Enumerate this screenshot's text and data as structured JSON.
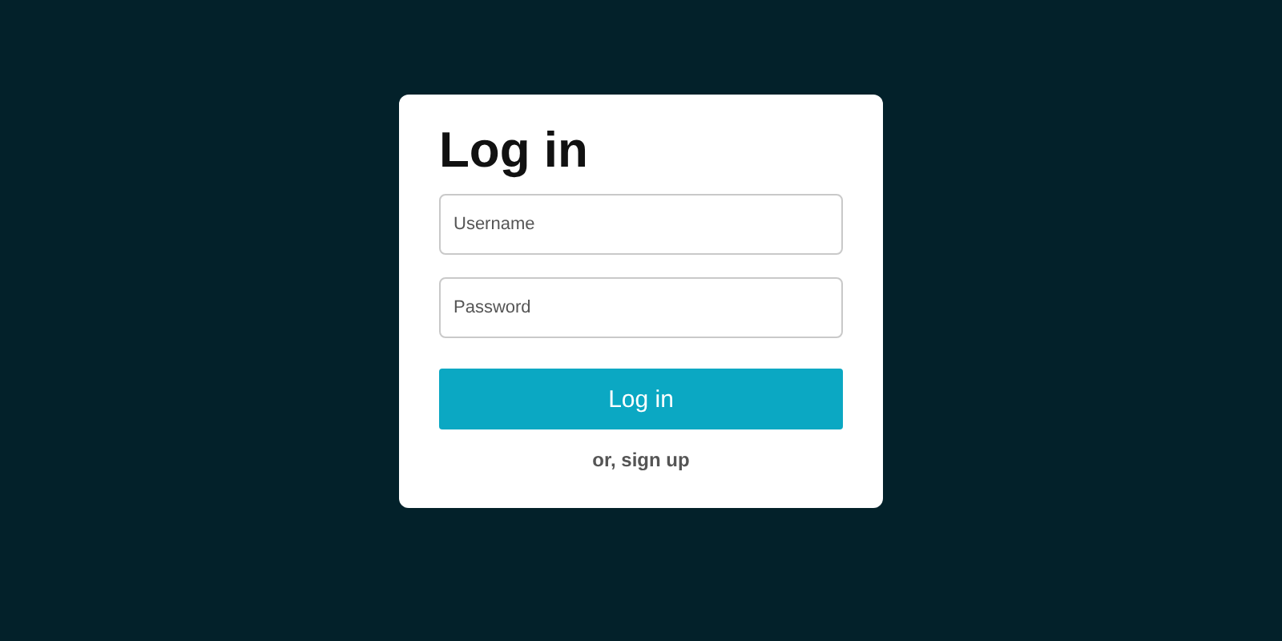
{
  "login_card": {
    "title": "Log in",
    "username": {
      "placeholder": "Username"
    },
    "password": {
      "placeholder": "Password"
    },
    "submit_button": "Log in",
    "signup_link": "or, sign up"
  }
}
